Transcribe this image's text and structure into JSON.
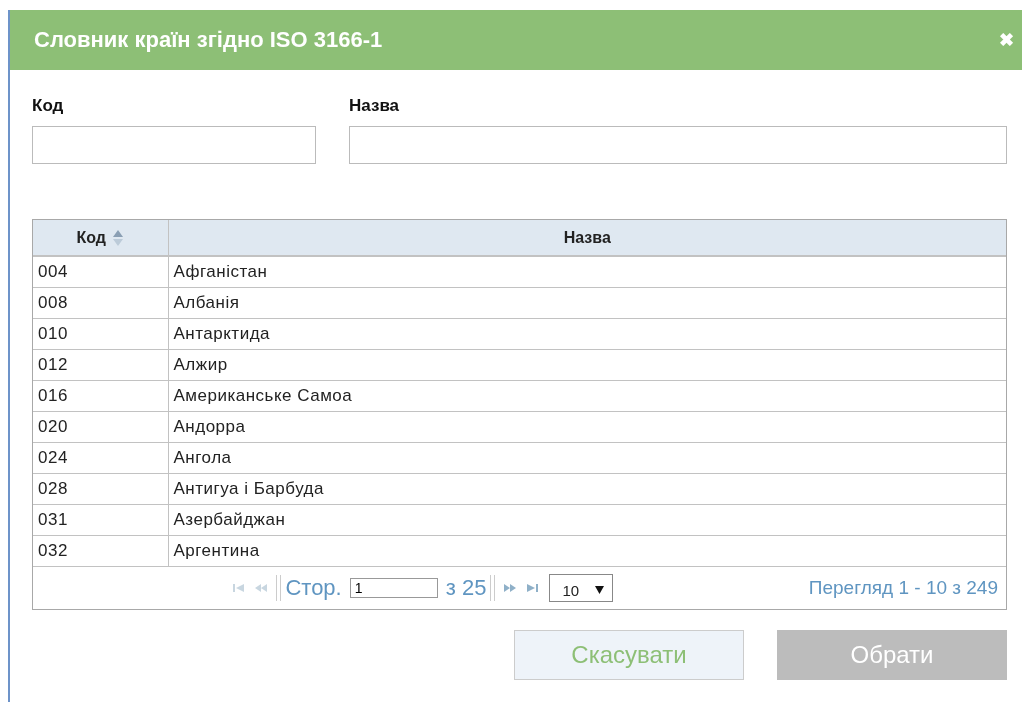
{
  "dialog": {
    "title": "Словник країн згідно ISO 3166-1",
    "close": "✖"
  },
  "filters": [
    {
      "label": "Код"
    },
    {
      "label": "Назва"
    }
  ],
  "table": {
    "columns": [
      {
        "label": "Код",
        "sorted": true
      },
      {
        "label": "Назва",
        "sorted": false
      }
    ],
    "rows": [
      [
        "004",
        "Афганістан"
      ],
      [
        "008",
        "Албанія"
      ],
      [
        "010",
        "Антарктида"
      ],
      [
        "012",
        "Алжир"
      ],
      [
        "016",
        "Американське Самоа"
      ],
      [
        "020",
        "Андорра"
      ],
      [
        "024",
        "Ангола"
      ],
      [
        "028",
        "Антигуа і Барбуда"
      ],
      [
        "031",
        "Азербайджан"
      ],
      [
        "032",
        "Аргентина"
      ]
    ]
  },
  "pager": {
    "nav": [
      {
        "kind": "first",
        "disabled": true
      },
      {
        "kind": "prev",
        "disabled": true
      },
      {
        "kind": "next",
        "disabled": false
      },
      {
        "kind": "last",
        "disabled": false
      }
    ],
    "page_label": "Стор.",
    "page": "1",
    "of_pages": "з 25",
    "page_size": "10",
    "summary": "Перегляд 1 - 10 з 249"
  },
  "buttons": [
    {
      "label": "Скасувати",
      "kind": "secondary",
      "disabled": false
    },
    {
      "label": "Обрати",
      "kind": "primary",
      "disabled": true
    }
  ]
}
